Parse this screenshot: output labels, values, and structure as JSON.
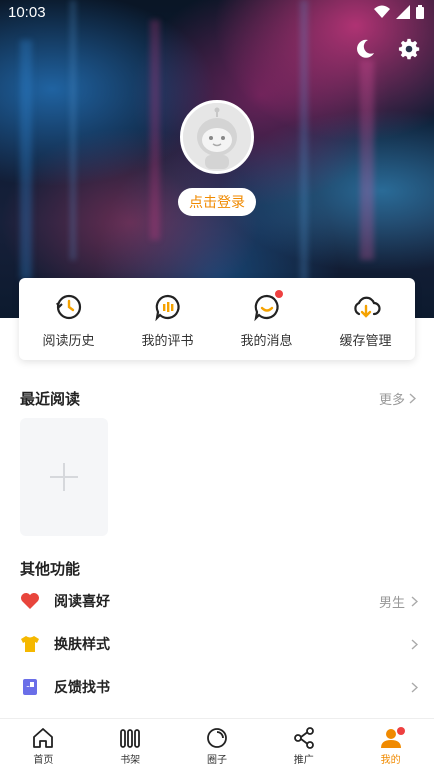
{
  "status_bar": {
    "time": "10:03"
  },
  "header": {
    "login_label": "点击登录",
    "icons": [
      "moon-icon",
      "gear-icon"
    ]
  },
  "quick_actions": [
    {
      "label": "阅读历史",
      "icon": "history-icon",
      "badge": false
    },
    {
      "label": "我的评书",
      "icon": "comment-icon",
      "badge": false
    },
    {
      "label": "我的消息",
      "icon": "message-icon",
      "badge": true
    },
    {
      "label": "缓存管理",
      "icon": "cloud-download-icon",
      "badge": false
    }
  ],
  "recent": {
    "title": "最近阅读",
    "more_label": "更多"
  },
  "other": {
    "title": "其他功能",
    "items": [
      {
        "label": "阅读喜好",
        "value": "男生",
        "icon": "heart-icon",
        "color": "#e8453c"
      },
      {
        "label": "换肤样式",
        "value": "",
        "icon": "tshirt-icon",
        "color": "#f5b800"
      },
      {
        "label": "反馈找书",
        "value": "",
        "icon": "book-icon",
        "color": "#6a6ee8"
      }
    ]
  },
  "bottom_nav": [
    {
      "label": "首页",
      "icon": "home-icon",
      "active": false
    },
    {
      "label": "书架",
      "icon": "bookshelf-icon",
      "active": false
    },
    {
      "label": "圈子",
      "icon": "circle-icon",
      "active": false
    },
    {
      "label": "推广",
      "icon": "share-icon",
      "active": false
    },
    {
      "label": "我的",
      "icon": "user-icon",
      "active": true
    }
  ],
  "colors": {
    "accent": "#f08a00",
    "badge": "#ee4040"
  }
}
